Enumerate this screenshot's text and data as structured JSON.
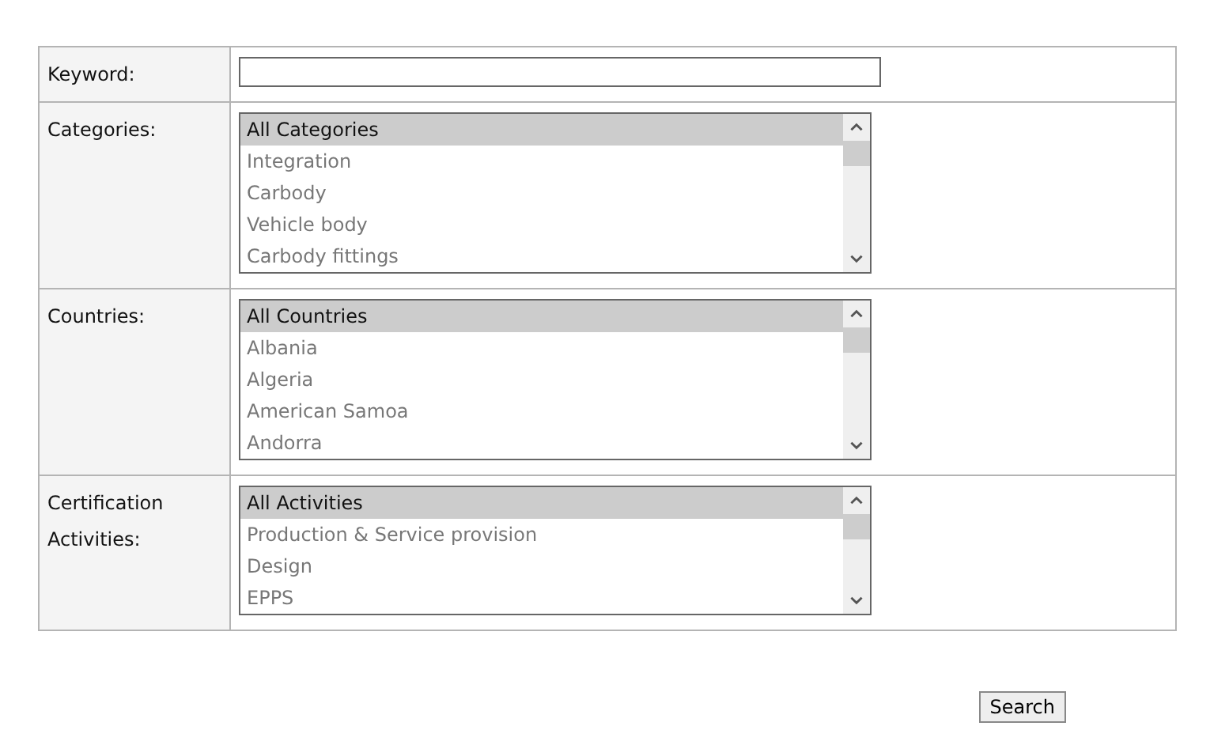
{
  "form": {
    "keyword": {
      "label": "Keyword:"
    },
    "lists": [
      {
        "label": "Categories:",
        "options": [
          {
            "text": "All Categories",
            "selected": true
          },
          {
            "text": "Integration",
            "selected": false
          },
          {
            "text": "Carbody",
            "selected": false
          },
          {
            "text": "Vehicle body",
            "selected": false
          },
          {
            "text": "Carbody fittings",
            "selected": false
          }
        ]
      },
      {
        "label": "Countries:",
        "options": [
          {
            "text": "All Countries",
            "selected": true
          },
          {
            "text": "Albania",
            "selected": false
          },
          {
            "text": "Algeria",
            "selected": false
          },
          {
            "text": "American Samoa",
            "selected": false
          },
          {
            "text": "Andorra",
            "selected": false
          }
        ]
      },
      {
        "label": "Certification Activities:",
        "options": [
          {
            "text": "All Activities",
            "selected": true
          },
          {
            "text": "Production & Service provision",
            "selected": false
          },
          {
            "text": "Design",
            "selected": false
          },
          {
            "text": "EPPS",
            "selected": false
          }
        ]
      }
    ]
  },
  "search_button": "Search"
}
